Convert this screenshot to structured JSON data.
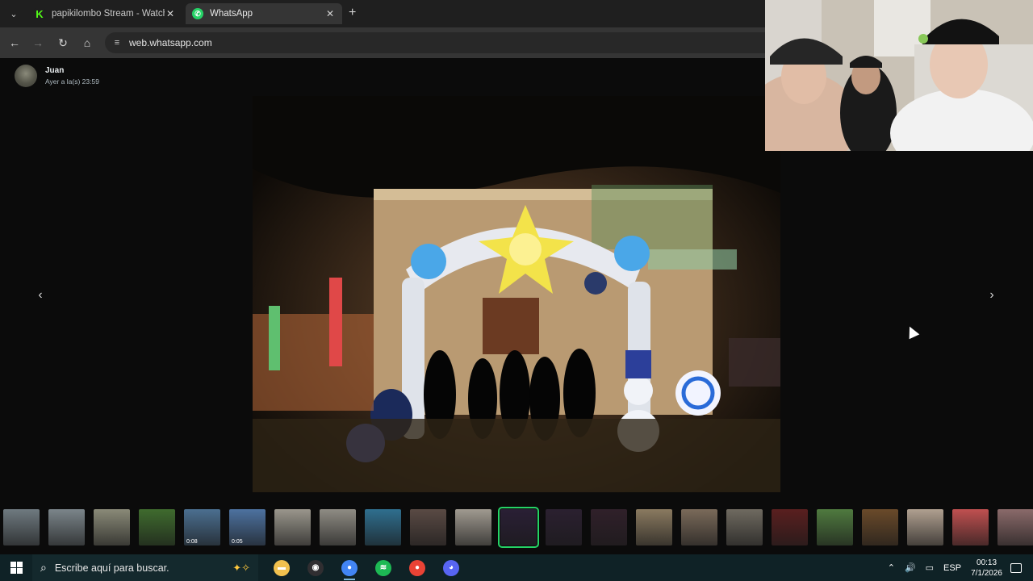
{
  "browser": {
    "tabs": [
      {
        "title": "papikilombo Stream - Watch Li",
        "icon": "kick-icon",
        "active": false
      },
      {
        "title": "WhatsApp",
        "icon": "whatsapp-icon",
        "active": true
      }
    ],
    "url": "web.whatsapp.com"
  },
  "viewer": {
    "sender_name": "Juan",
    "sender_time": "Ayer a la(s) 23:59",
    "prev_icon": "chevron-left-icon",
    "next_icon": "chevron-right-icon"
  },
  "thumbnails": [
    {
      "kind": "image",
      "tone": "#6f7a80"
    },
    {
      "kind": "image",
      "tone": "#7b858a"
    },
    {
      "kind": "image",
      "tone": "#8a8a78"
    },
    {
      "kind": "image",
      "tone": "#3f6b2e"
    },
    {
      "kind": "video",
      "tone": "#4b6f90",
      "duration": "0:08"
    },
    {
      "kind": "video",
      "tone": "#4d72a0",
      "duration": "0:05"
    },
    {
      "kind": "image",
      "tone": "#9a968c"
    },
    {
      "kind": "image",
      "tone": "#8f8c84"
    },
    {
      "kind": "image",
      "tone": "#2f6f8f"
    },
    {
      "kind": "image",
      "tone": "#5a4a44"
    },
    {
      "kind": "image",
      "tone": "#a09a90"
    },
    {
      "kind": "image",
      "tone": "#2a1f35",
      "selected": true
    },
    {
      "kind": "image",
      "tone": "#2b2030"
    },
    {
      "kind": "image",
      "tone": "#30202a"
    },
    {
      "kind": "image",
      "tone": "#8a7a60"
    },
    {
      "kind": "image",
      "tone": "#7a6a5a"
    },
    {
      "kind": "image",
      "tone": "#6f6a60"
    },
    {
      "kind": "image",
      "tone": "#5a1f1f"
    },
    {
      "kind": "image",
      "tone": "#4f7a3f"
    },
    {
      "kind": "image",
      "tone": "#6a4a2a"
    },
    {
      "kind": "image",
      "tone": "#b0a090"
    },
    {
      "kind": "image",
      "tone": "#c05050"
    },
    {
      "kind": "image",
      "tone": "#8a6a6a"
    }
  ],
  "taskbar": {
    "search_placeholder": "Escribe aquí para buscar.",
    "apps": [
      {
        "name": "file-explorer-icon",
        "color": "#f2c14e"
      },
      {
        "name": "obs-icon",
        "color": "#302e31"
      },
      {
        "name": "chrome-icon",
        "color": "#4285f4",
        "active": true
      },
      {
        "name": "spotify-icon",
        "color": "#1db954"
      },
      {
        "name": "chrome-icon",
        "color": "#ea4335"
      },
      {
        "name": "discord-icon",
        "color": "#5865f2"
      }
    ],
    "language": "ESP",
    "time": "00:13",
    "date": "7/1/2026"
  }
}
